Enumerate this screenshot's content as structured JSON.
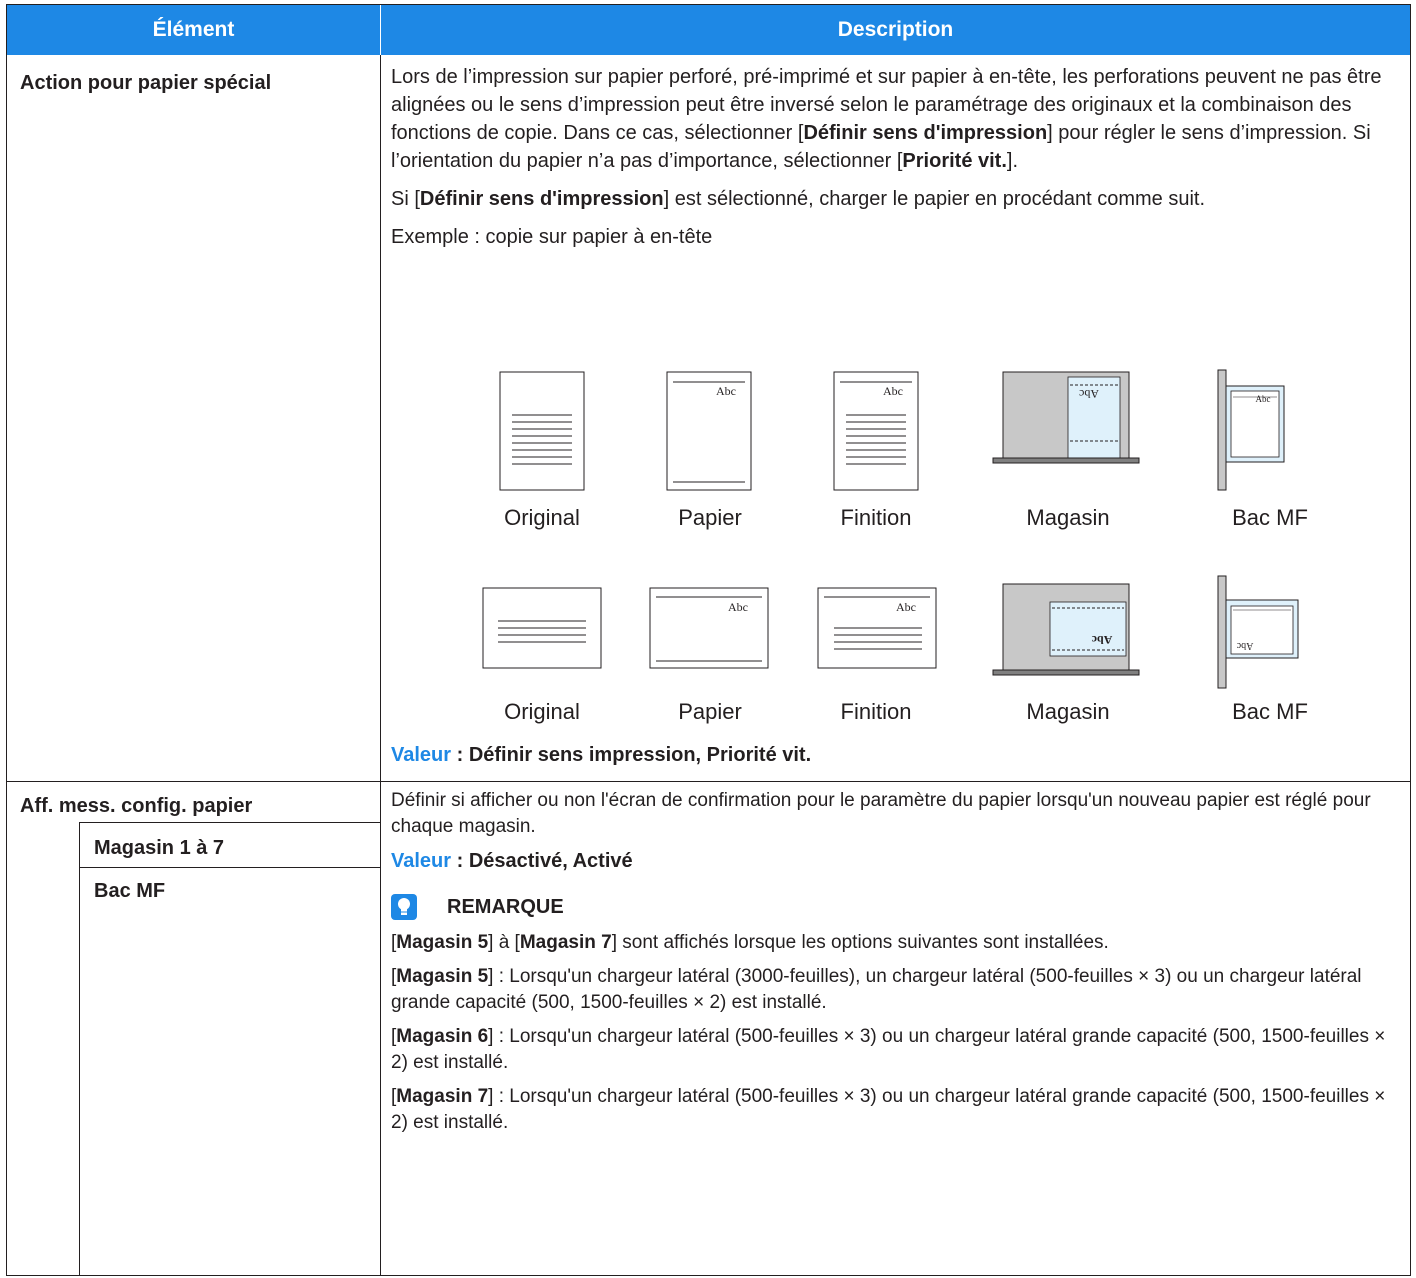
{
  "header": {
    "col1": "Élément",
    "col2": "Description"
  },
  "row1": {
    "label": "Action pour papier spécial",
    "p1": {
      "a": "Lors de l’impression sur papier perforé, pré-imprimé et sur papier à en-tête, les perforations peuvent ne pas être alignées ou le sens d’impression peut être inversé selon le paramétrage des originaux et la combinaison des fonctions de copie. Dans ce cas, sélectionner [",
      "b": "Définir sens d'impression",
      "c": "] pour régler le sens d’impression. Si l’orientation du papier n’a pas d’importance, sélectionner [",
      "d": "Priorité vit.",
      "e": "]."
    },
    "p2": {
      "a": "Si [",
      "b": "Définir sens d'impression",
      "c": "] est sélectionné, charger le papier en procédant comme suit."
    },
    "example": "Exemple : copie sur papier à en-tête",
    "figure_text": {
      "abc": "Abc",
      "abc_mirror": "Abc"
    },
    "figure_labels_row1": [
      "Original",
      "Papier",
      "Finition",
      "Magasin",
      "Bac MF"
    ],
    "figure_labels_row2": [
      "Original",
      "Papier",
      "Finition",
      "Magasin",
      "Bac MF"
    ],
    "value_prefix": "Valeur",
    "value_text": " : Définir sens impression, Priorité vit."
  },
  "row2": {
    "label": "Aff. mess. config. papier",
    "sub1": "Magasin 1 à 7",
    "sub2": "Bac MF",
    "p1": "Définir si afficher ou non l'écran de confirmation pour le paramètre du papier lorsqu'un nouveau papier est réglé pour chaque magasin.",
    "value_prefix": "Valeur",
    "value_text": " : Désactivé, Activé",
    "note_title": "REMARQUE",
    "note1": {
      "a": "[",
      "b": "Magasin 5",
      "c": "] à [",
      "d": "Magasin 7",
      "e": "] sont affichés lorsque les options suivantes sont installées."
    },
    "note2": {
      "a": "[",
      "b": "Magasin 5",
      "c": "] : Lorsqu'un chargeur latéral (3000-feuilles), un chargeur latéral (500-feuilles × 3) ou un chargeur latéral grande capacité (500, 1500-feuilles × 2) est installé."
    },
    "note3": {
      "a": "[",
      "b": "Magasin 6",
      "c": "] : Lorsqu'un chargeur latéral (500-feuilles × 3) ou un chargeur latéral grande capacité (500, 1500-feuilles × 2) est installé."
    },
    "note4": {
      "a": "[",
      "b": "Magasin 7",
      "c": "] : Lorsqu'un chargeur latéral (500-feuilles × 3) ou un chargeur latéral grande capacité (500, 1500-feuilles × 2) est installé."
    }
  },
  "colors": {
    "header_bg": "#1e88e5",
    "accent": "#1e88e5",
    "text": "#231f20",
    "tray_gray": "#c8c8c8",
    "paper_tint": "#dff1fb"
  }
}
